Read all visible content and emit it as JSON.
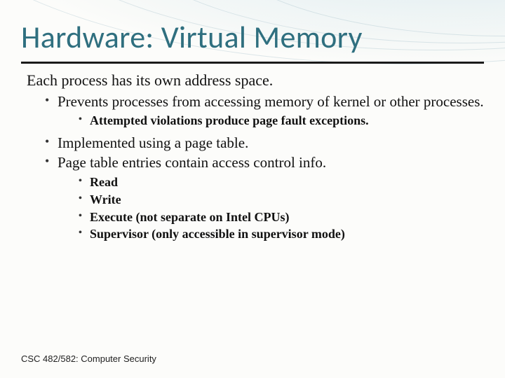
{
  "title": "Hardware: Virtual Memory",
  "lead": "Each process has its own address space.",
  "bullets": {
    "b1": "Prevents processes from accessing memory of kernel or other processes.",
    "b1_sub1": "Attempted violations produce page fault exceptions.",
    "b2": "Implemented using a page table.",
    "b3": "Page table entries contain access control info.",
    "b3_sub1": "Read",
    "b3_sub2": "Write",
    "b3_sub3": "Execute (not separate on Intel CPUs)",
    "b3_sub4": "Supervisor (only accessible in supervisor mode)"
  },
  "footer": "CSC 482/582: Computer Security"
}
